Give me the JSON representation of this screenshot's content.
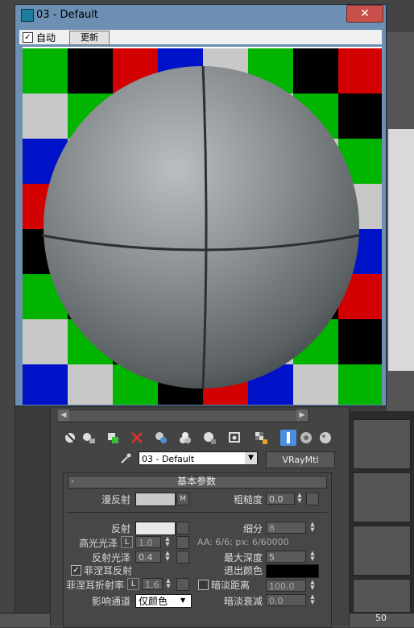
{
  "window": {
    "title": "03 - Default",
    "close_glyph": "✕",
    "auto_label": "自动",
    "auto_checked": true,
    "update_label": "更新"
  },
  "preview": {
    "checker_colors": [
      "#00b400",
      "#0012c8",
      "#000000",
      "#c8c8c8",
      "#d20000"
    ],
    "sphere_color": "#7b8082"
  },
  "editor": {
    "material_name": "03 - Default",
    "material_type": "VRayMtl",
    "toolbar_icons": [
      "get-material-icon",
      "put-to-scene-icon",
      "assign-to-selection-icon",
      "delete-icon",
      "make-unique-icon",
      "put-to-library-icon",
      "material-id-icon",
      "show-in-viewport-icon",
      "show-end-result-icon",
      "go-to-parent-icon",
      "go-forward-icon",
      "sample-type-icon",
      "backlight-icon",
      "background-icon"
    ]
  },
  "rollout": {
    "title": "基本参数",
    "collapse_glyph": "-",
    "diffuse_label": "漫反射",
    "diffuse_map_btn": "M",
    "diffuse_color": "#c8c8c8",
    "roughness_label": "粗糙度",
    "roughness_value": "0.0",
    "reflect_label": "反射",
    "reflect_color": "#e8e8e8",
    "subdivs_label": "细分",
    "subdivs_value": "8",
    "hilight_gloss_label": "高光光泽",
    "hilight_lock": "L",
    "hilight_gloss_value": "1.0",
    "aa_info": "AA: 6/6; px: 6/60000",
    "refl_gloss_label": "反射光泽",
    "refl_gloss_value": "0.4",
    "max_depth_label": "最大深度",
    "max_depth_value": "5",
    "fresnel_label": "菲涅耳反射",
    "fresnel_checked": true,
    "exit_color_label": "退出颜色",
    "exit_color": "#000000",
    "fresnel_ior_label": "菲涅耳折射率",
    "fresnel_lock": "L",
    "fresnel_ior_value": "1.6",
    "dim_distance_label": "暗淡距离",
    "dim_distance_checked": false,
    "dim_distance_value": "100.0",
    "affect_channels_label": "影响通道",
    "affect_channels_value": "仅颜色",
    "dim_falloff_label": "暗淡衰减",
    "dim_falloff_value": "0.0"
  },
  "bottom": {
    "ruler_number": "50"
  }
}
